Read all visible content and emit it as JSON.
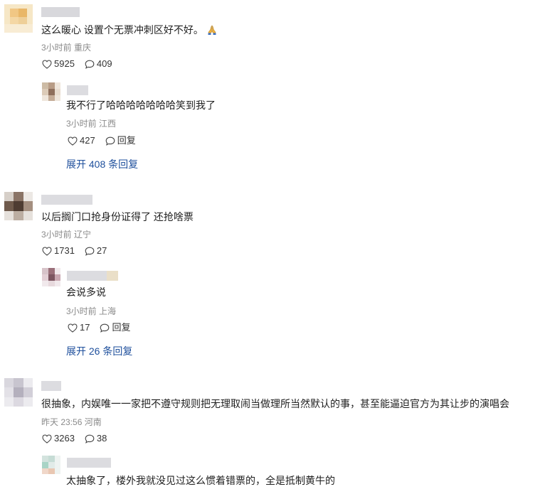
{
  "comments": [
    {
      "text": "这么暖心 设置个无票冲刺区好不好。",
      "emoji": "pray-icon",
      "time": "3小时前",
      "location": "重庆",
      "likes": "5925",
      "replies": "409",
      "reply": {
        "text": "我不行了哈哈哈哈哈哈哈笑到我了",
        "time": "3小时前",
        "location": "江西",
        "likes": "427",
        "reply_label": "回复"
      },
      "expand": "展开 408 条回复"
    },
    {
      "text": "以后搁门口抢身份证得了 还抢啥票",
      "time": "3小时前",
      "location": "辽宁",
      "likes": "1731",
      "replies": "27",
      "reply": {
        "text": "会说多说",
        "time": "3小时前",
        "location": "上海",
        "likes": "17",
        "reply_label": "回复"
      },
      "expand": "展开 26 条回复"
    },
    {
      "text": "很抽象，内娱唯一一家把不遵守规则把无理取闹当做理所当然默认的事，甚至能逼迫官方为其让步的演唱会",
      "time": "昨天 23:56",
      "location": "河南",
      "likes": "3263",
      "replies": "38",
      "reply": {
        "text": "太抽象了，楼外我就没见过这么惯着错票的，全是抵制黄牛的"
      }
    }
  ],
  "colors": {
    "link": "#1e4f9c",
    "meta": "#8a8a8a",
    "text": "#1f1f1f"
  }
}
